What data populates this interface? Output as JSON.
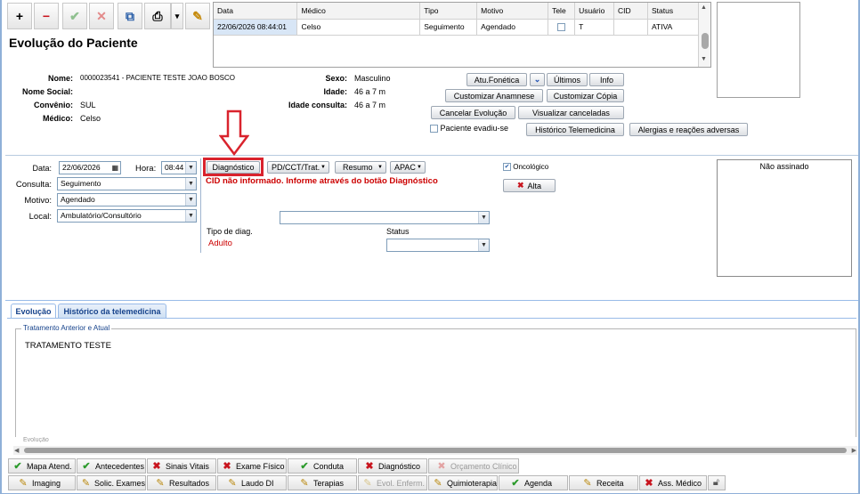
{
  "toolbar": {
    "add": "+",
    "remove": "−",
    "confirm": "✔",
    "cancel": "✕",
    "copy": "⧉",
    "print": "⎙",
    "dropdown": "▾",
    "edit": "✎"
  },
  "page_title": "Evolução do Paciente",
  "grid": {
    "headers": [
      "Data",
      "Médico",
      "Tipo",
      "Motivo",
      "Tele",
      "Usuário",
      "CID",
      "Status"
    ],
    "row": {
      "data": "22/06/2026 08:44:01",
      "medico": "Celso",
      "tipo": "Seguimento",
      "motivo": "Agendado",
      "usuario": "T",
      "cid": "",
      "status": "ATIVA"
    }
  },
  "patient": {
    "nome_label": "Nome:",
    "nome": "0000023541 - PACIENTE TESTE JOAO BOSCO",
    "social_label": "Nome Social:",
    "social": "",
    "convenio_label": "Convênio:",
    "convenio": "SUL",
    "medico_label": "Médico:",
    "medico": "Celso",
    "sexo_label": "Sexo:",
    "sexo": "Masculino",
    "idade_label": "Idade:",
    "idade": "46 a 7 m",
    "idade_consulta_label": "Idade consulta:",
    "idade_consulta": "46 a 7 m"
  },
  "actions": {
    "atu_fonetica": "Atu.Fonética",
    "ultimos": "Últimos",
    "info": "Info",
    "custom_anamnese": "Customizar Anamnese",
    "custom_copia": "Customizar Cópia",
    "cancelar_evolucao": "Cancelar Evolução",
    "visualizar_canceladas": "Visualizar canceladas",
    "evadiu": "Paciente evadiu-se",
    "historico_tele": "Histórico Telemedicina",
    "alergias": "Alergias e reações adversas"
  },
  "form": {
    "data_label": "Data:",
    "data": "22/06/2026",
    "hora_label": "Hora:",
    "hora": "08:44",
    "consulta_label": "Consulta:",
    "consulta": "Seguimento",
    "motivo_label": "Motivo:",
    "motivo": "Agendado",
    "local_label": "Local:",
    "local": "Ambulatório/Consultório"
  },
  "diag": {
    "diagnostico": "Diagnóstico",
    "pd": "PD/CCT/Trat.",
    "resumo": "Resumo",
    "apac": "APAC",
    "warning": "CID não informado. Informe através do botão Diagnóstico",
    "tipo_diag_label": "Tipo de diag.",
    "status_label": "Status",
    "adulto": "Adulto"
  },
  "oncologico": "Oncológico",
  "alta": "Alta",
  "nao_assinado": "Não assinado",
  "tabs": [
    "Evolução",
    "Histórico da telemedicina"
  ],
  "fieldset_legend": "Tratamento Anterior e Atual",
  "evolucao_text": "TRATAMENTO TESTE",
  "cut_label": "Evolução",
  "bottom1": [
    "Mapa Atend.",
    "Antecedentes",
    "Sinais Vitais",
    "Exame Físico",
    "Conduta",
    "Diagnóstico",
    "Orçamento Clínico"
  ],
  "bottom2": [
    "Imaging",
    "Solic. Exames",
    "Resultados",
    "Laudo DI",
    "Terapias",
    "Evol. Enferm.",
    "Quimioterapia",
    "Agenda",
    "Receita",
    "Ass. Médico"
  ],
  "colors": {
    "accent": "#15428b",
    "warning": "#cc0000",
    "highlight_box": "#d9232d",
    "arrow": "#d9232d"
  }
}
